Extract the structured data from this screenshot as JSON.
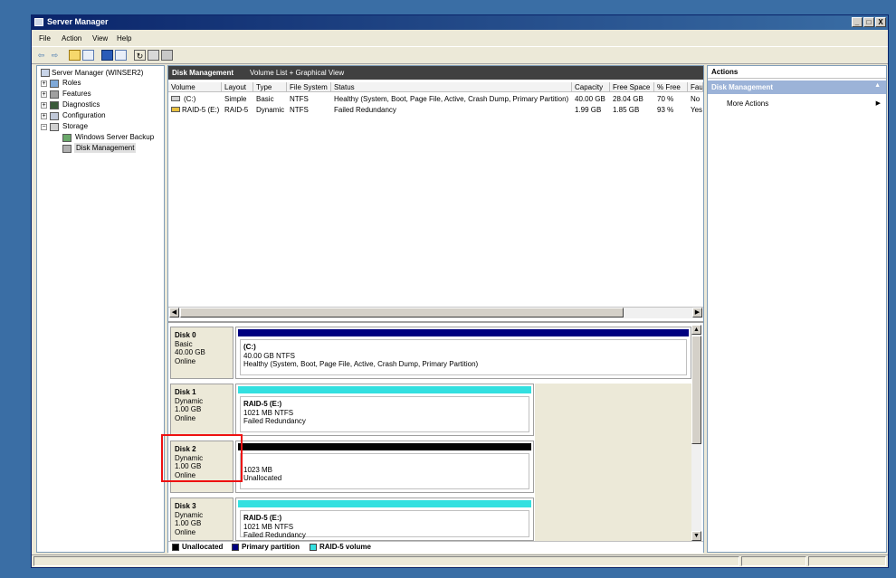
{
  "window": {
    "title": "Server Manager",
    "controls": [
      "_",
      "□",
      "X"
    ]
  },
  "menu": [
    "File",
    "Action",
    "View",
    "Help"
  ],
  "tree": {
    "root": "Server Manager (WINSER2)",
    "items": [
      "Roles",
      "Diagnostics",
      "Configuration",
      "Storage"
    ],
    "features": "Features",
    "storage_children": [
      "Windows Server Backup",
      "Disk Management"
    ]
  },
  "center": {
    "title": "Disk Management",
    "subtitle": "Volume List + Graphical View",
    "columns": [
      "Volume",
      "Layout",
      "Type",
      "File System",
      "Status",
      "Capacity",
      "Free Space",
      "% Free",
      "Fau"
    ],
    "rows": [
      [
        "(C:)",
        "Simple",
        "Basic",
        "NTFS",
        "Healthy (System, Boot, Page File, Active, Crash Dump, Primary Partition)",
        "40.00 GB",
        "28.04 GB",
        "70 %",
        "No"
      ],
      [
        "RAID-5 (E:)",
        "RAID-5",
        "Dynamic",
        "NTFS",
        "Failed Redundancy",
        "1.99 GB",
        "1.85 GB",
        "93 %",
        "Yes"
      ]
    ]
  },
  "disks": [
    {
      "name": "Disk 0",
      "type": "Basic",
      "size": "40.00 GB",
      "state": "Online",
      "vol_name": "(C:)",
      "vol_size": "40.00 GB NTFS",
      "vol_status": "Healthy (System, Boot, Page File, Active, Crash Dump, Primary Partition)"
    },
    {
      "name": "Disk 1",
      "type": "Dynamic",
      "size": "1.00 GB",
      "state": "Online",
      "vol_name": "RAID-5  (E:)",
      "vol_size": "1021 MB NTFS",
      "vol_status": "Failed Redundancy"
    },
    {
      "name": "Disk 2",
      "type": "Dynamic",
      "size": "1.00 GB",
      "state": "Online",
      "vol_name": "",
      "vol_size": "1023 MB",
      "vol_status": "Unallocated"
    },
    {
      "name": "Disk 3",
      "type": "Dynamic",
      "size": "1.00 GB",
      "state": "Online",
      "vol_name": "RAID-5  (E:)",
      "vol_size": "1021 MB NTFS",
      "vol_status": "Failed Redundancy"
    }
  ],
  "legend": [
    {
      "label": "Unallocated",
      "color": "#000000"
    },
    {
      "label": "Primary partition",
      "color": "#00007f"
    },
    {
      "label": "RAID-5 volume",
      "color": "#33e0e0"
    }
  ],
  "actions": {
    "title": "Actions",
    "section": "Disk Management",
    "more": "More Actions"
  },
  "colors": {
    "primary_partition": "#00007f",
    "raid5": "#33e0e0",
    "unallocated": "#000000",
    "highlight_box": "#ee1111"
  }
}
